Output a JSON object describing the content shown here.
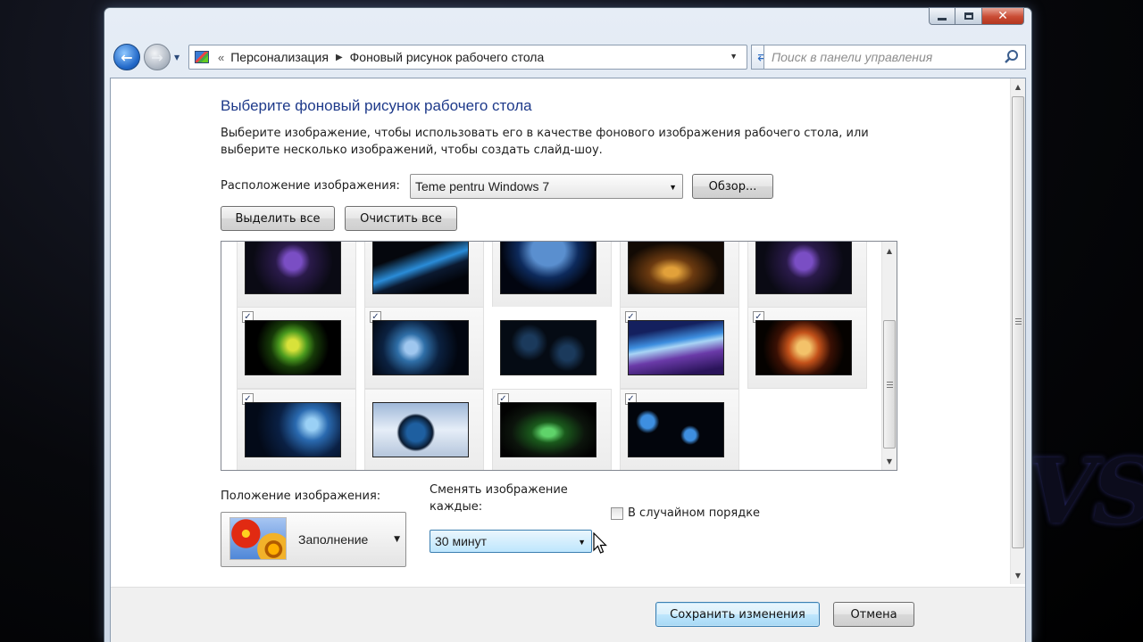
{
  "window": {
    "caption": {
      "minimize": "minimize-icon",
      "maximize": "maximize-icon",
      "close": "✕"
    }
  },
  "nav": {
    "back_icon": "back-arrow-icon",
    "forward_icon": "forward-arrow-icon",
    "breadcrumb": [
      "Персонализация",
      "Фоновый рисунок рабочего стола"
    ],
    "breadcrumb_prefix": "«",
    "search_placeholder": "Поиск в панели управления"
  },
  "page": {
    "heading": "Выберите фоновый рисунок рабочего стола",
    "description": "Выберите изображение, чтобы использовать его в качестве фонового изображения рабочего стола, или выберите несколько изображений, чтобы создать слайд-шоу.",
    "location_label": "Расположение изображения:",
    "location_value": "Teme pentru Windows  7",
    "browse_label": "Обзор...",
    "select_all_label": "Выделить все",
    "clear_all_label": "Очистить все"
  },
  "gallery": {
    "rows": [
      [
        {
          "checked": false,
          "theme": "purple-flower"
        },
        {
          "checked": false,
          "theme": "blue-streaks"
        },
        {
          "checked": false,
          "theme": "planet"
        },
        {
          "checked": false,
          "theme": "golden-light"
        },
        {
          "checked": false,
          "theme": "purple-flower-2"
        }
      ],
      [
        {
          "checked": true,
          "theme": "green-leaf"
        },
        {
          "checked": true,
          "theme": "blue-globe"
        },
        {
          "checked": false,
          "theme": "dark-pattern"
        },
        {
          "checked": true,
          "theme": "blue-wave"
        },
        {
          "checked": true,
          "theme": "orange-glow"
        }
      ],
      [
        {
          "checked": true,
          "theme": "windows7-fairy"
        },
        {
          "checked": false,
          "theme": "hand-globe"
        },
        {
          "checked": true,
          "theme": "green-gate"
        },
        {
          "checked": true,
          "theme": "windows-logos"
        }
      ]
    ]
  },
  "position": {
    "label": "Положение изображения:",
    "value": "Заполнение"
  },
  "interval": {
    "label": "Сменять изображение каждые:",
    "value": "30 минут"
  },
  "shuffle": {
    "label": "В случайном порядке",
    "checked": false
  },
  "footer": {
    "save_label": "Сохранить изменения",
    "cancel_label": "Отмена"
  },
  "background": {
    "watermark_text": "VS"
  }
}
